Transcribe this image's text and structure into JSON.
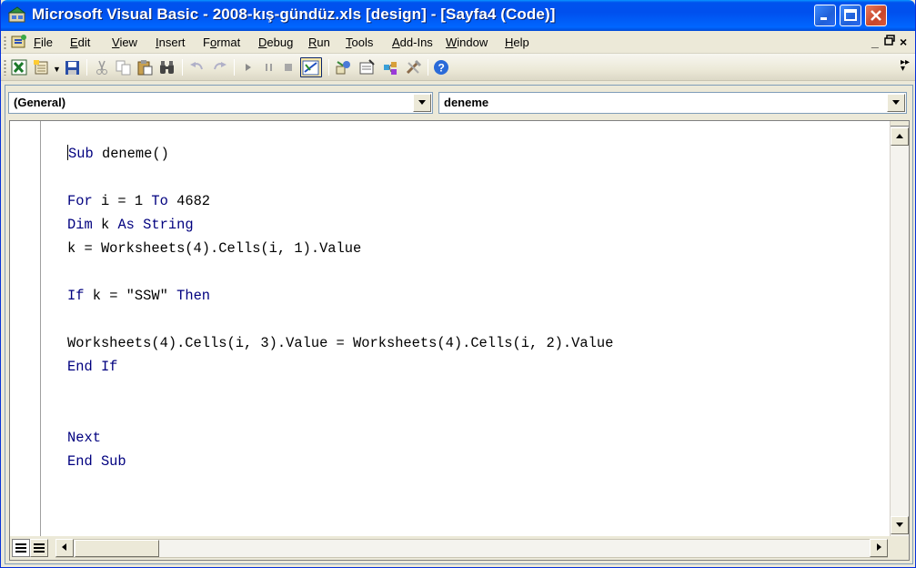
{
  "window": {
    "title": "Microsoft Visual Basic - 2008-kış-gündüz.xls [design] - [Sayfa4 (Code)]"
  },
  "colors": {
    "titlebar": "#0053ee",
    "keyword": "#00007f",
    "close": "#c8462a"
  },
  "menu": {
    "items": [
      {
        "pre": "",
        "ul": "F",
        "post": "ile"
      },
      {
        "pre": "",
        "ul": "E",
        "post": "dit"
      },
      {
        "pre": "",
        "ul": "V",
        "post": "iew"
      },
      {
        "pre": "",
        "ul": "I",
        "post": "nsert"
      },
      {
        "pre": "F",
        "ul": "o",
        "post": "rmat"
      },
      {
        "pre": "",
        "ul": "D",
        "post": "ebug"
      },
      {
        "pre": "",
        "ul": "R",
        "post": "un"
      },
      {
        "pre": "",
        "ul": "T",
        "post": "ools"
      },
      {
        "pre": "",
        "ul": "A",
        "post": "dd-Ins"
      },
      {
        "pre": "",
        "ul": "W",
        "post": "indow"
      },
      {
        "pre": "",
        "ul": "H",
        "post": "elp"
      }
    ],
    "minimize_glyph": "_",
    "restore_glyph": "🗗",
    "close_glyph": "×"
  },
  "toolbar": {
    "icons": [
      "view-excel-icon",
      "insert-module-icon",
      "save-icon",
      "cut-icon",
      "copy-icon",
      "paste-icon",
      "find-icon",
      "undo-icon",
      "redo-icon",
      "run-icon",
      "break-icon",
      "reset-icon",
      "design-mode-icon",
      "project-explorer-icon",
      "properties-icon",
      "object-browser-icon",
      "toolbox-icon",
      "help-icon"
    ]
  },
  "code_window": {
    "object_combo": "(General)",
    "procedure_combo": "deneme",
    "lines": [
      [
        {
          "t": "Sub",
          "k": true
        },
        {
          "t": " deneme()",
          "k": false
        }
      ],
      [],
      [
        {
          "t": "For",
          "k": true
        },
        {
          "t": " i = 1 ",
          "k": false
        },
        {
          "t": "To",
          "k": true
        },
        {
          "t": " 4682",
          "k": false
        }
      ],
      [
        {
          "t": "Dim",
          "k": true
        },
        {
          "t": " k ",
          "k": false
        },
        {
          "t": "As String",
          "k": true
        }
      ],
      [
        {
          "t": "k = Worksheets(4).Cells(i, 1).Value",
          "k": false
        }
      ],
      [],
      [
        {
          "t": "If",
          "k": true
        },
        {
          "t": " k = \"SSW\" ",
          "k": false
        },
        {
          "t": "Then",
          "k": true
        }
      ],
      [],
      [
        {
          "t": "Worksheets(4).Cells(i, 3).Value = Worksheets(4).Cells(i, 2).Value",
          "k": false
        }
      ],
      [
        {
          "t": "End If",
          "k": true
        }
      ],
      [],
      [],
      [
        {
          "t": "Next",
          "k": true
        }
      ],
      [
        {
          "t": "End Sub",
          "k": true
        }
      ]
    ]
  }
}
